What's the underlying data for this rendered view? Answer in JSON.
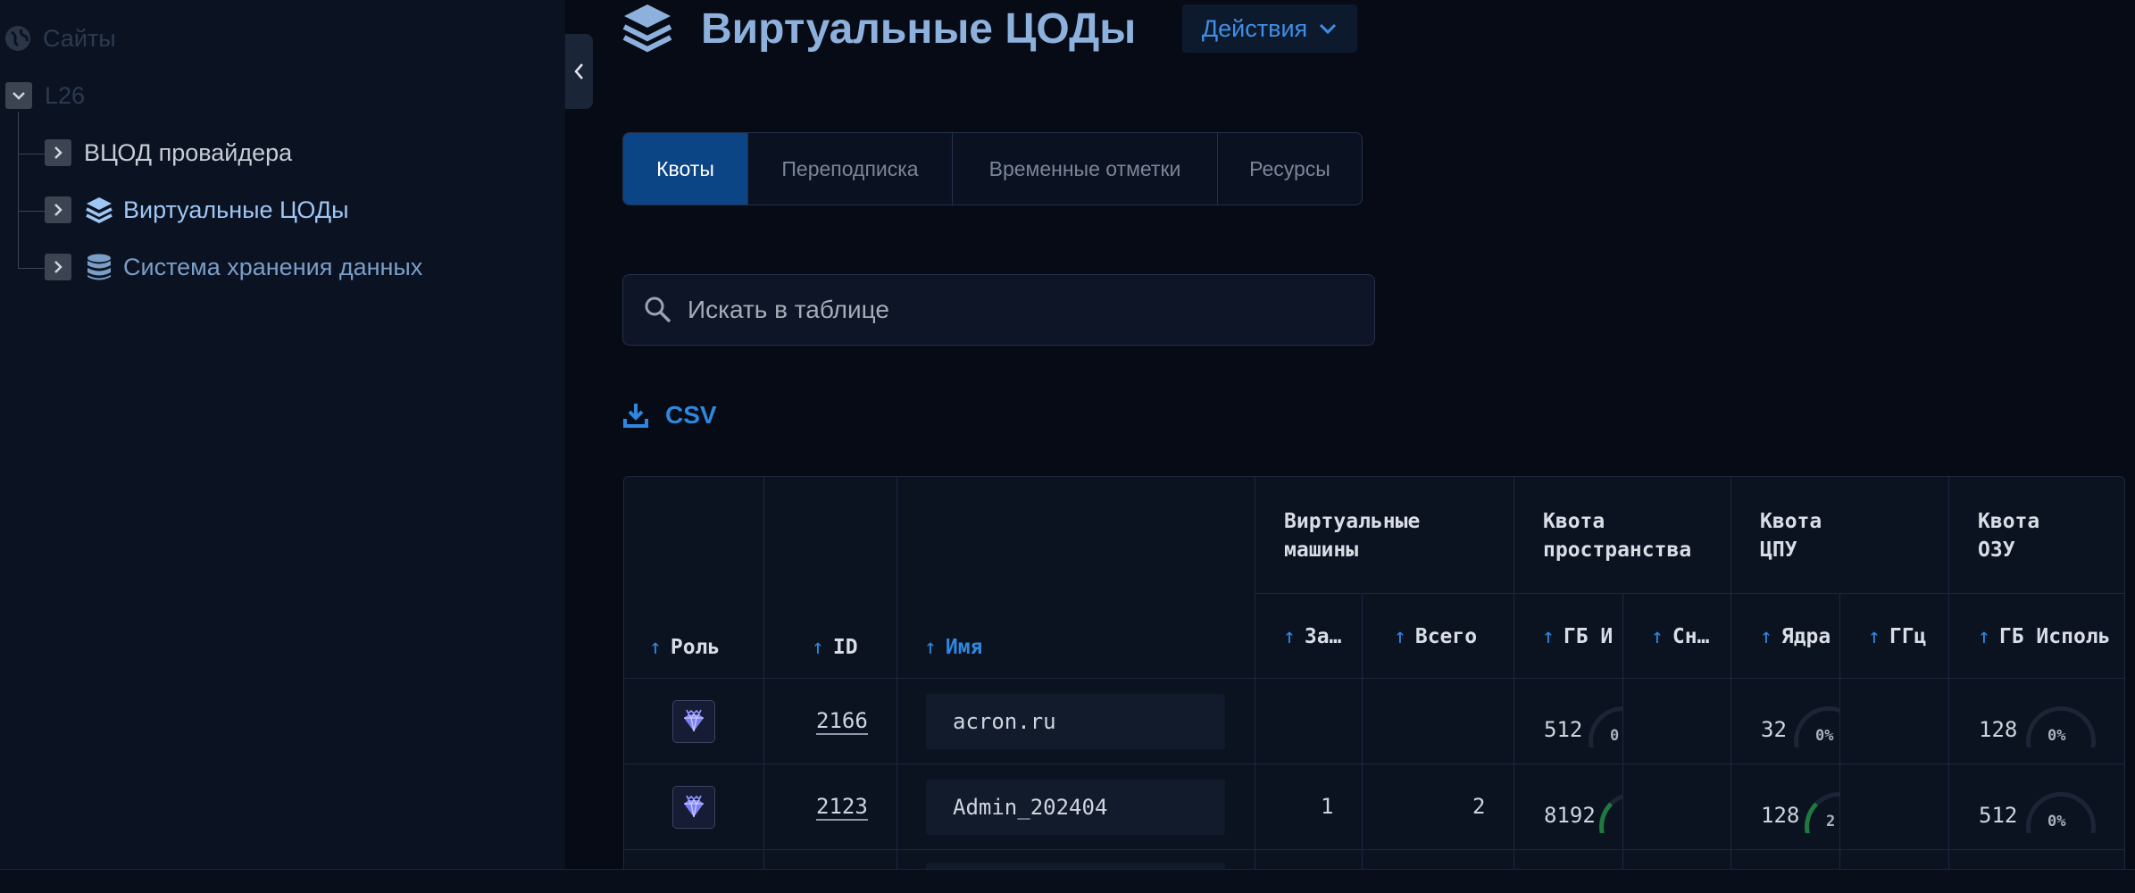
{
  "sidebar": {
    "items": [
      {
        "label": "Сайты",
        "icon": "globe-icon"
      },
      {
        "label": "L26",
        "icon": "chevron-down-icon"
      },
      {
        "label": "ВЦОД провайдера",
        "icon": "chevron-right-icon"
      },
      {
        "label": "Виртуальные ЦОДы",
        "icon": "layers-icon"
      },
      {
        "label": "Система хранения данных",
        "icon": "database-icon"
      }
    ]
  },
  "header": {
    "title": "Виртуальные ЦОДы",
    "icon": "layers-icon",
    "actions_label": "Действия"
  },
  "tabs": [
    {
      "label": "Квоты",
      "active": true
    },
    {
      "label": "Переподписка",
      "active": false
    },
    {
      "label": "Временные отметки",
      "active": false
    },
    {
      "label": "Ресурсы",
      "active": false
    }
  ],
  "search": {
    "placeholder": "Искать в таблице"
  },
  "csv": {
    "label": "CSV"
  },
  "table": {
    "sort_arrow": "↑",
    "columns": {
      "role": "Роль",
      "id": "ID",
      "name": "Имя"
    },
    "groups": {
      "vm": "Виртуальные машины",
      "space": "Квота пространства",
      "cpu": "Квота ЦПУ",
      "ram": "Квота ОЗУ"
    },
    "subcolumns": {
      "vm_on": "За…",
      "vm_total": "Всего",
      "space_gb": "ГБ",
      "space_used": "И",
      "space_snap": "Сн…",
      "cpu_cores": "Ядра",
      "cpu_ghz": "ГГц",
      "ram_gb": "ГБ",
      "ram_used": "Исполь"
    },
    "rows": [
      {
        "id": "2166",
        "name": "acron.ru",
        "vm_on": "",
        "vm_total": "",
        "space_gb": "512",
        "space_pct": "0",
        "cpu_cores": "32",
        "cpu_pct": "0%",
        "ram_gb": "128",
        "ram_pct": "0%"
      },
      {
        "id": "2123",
        "name": "Admin_202404",
        "vm_on": "1",
        "vm_total": "2",
        "space_gb": "8192",
        "space_pct": "",
        "cpu_cores": "128",
        "cpu_pct": "2",
        "ram_gb": "512",
        "ram_pct": "0%"
      }
    ]
  },
  "colors": {
    "accent": "#2f87e0",
    "tab_active": "#0b4586",
    "background": "#060b16",
    "sidebar": "#0b1322"
  }
}
